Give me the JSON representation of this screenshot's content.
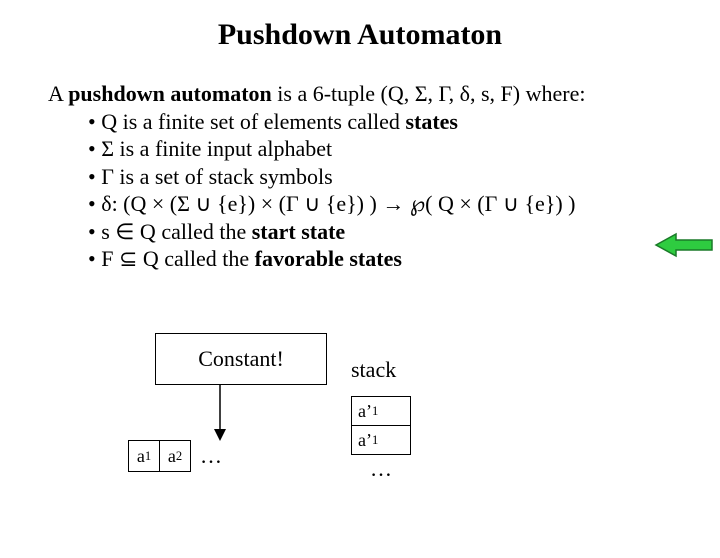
{
  "title": "Pushdown Automaton",
  "intro_prefix": "A ",
  "intro_bold": "pushdown automaton",
  "intro_suffix": " is a 6-tuple (Q, Σ, Γ, δ, s, F) where:",
  "bullets": {
    "b1_pre": "• Q is a finite set of elements called ",
    "b1_bold": "states",
    "b2": "• Σ is a finite input alphabet",
    "b3": "• Γ is a set of stack symbols",
    "b4": "• δ: (Q × (Σ ∪ {e}) × (Γ ∪ {e}) )  →  ℘( Q × (Γ ∪ {e}) )",
    "b5_pre": "• s ∈ Q called the ",
    "b5_bold": "start state",
    "b6_pre": "• F ⊆ Q called the ",
    "b6_bold": "favorable states"
  },
  "constant_label": "Constant!",
  "tape": {
    "a1_base": "a",
    "a1_sub": "1",
    "a2_base": "a",
    "a2_sub": "2",
    "dots": "…"
  },
  "stack_label": "stack",
  "stack": {
    "c1_base": "a’",
    "c1_sub": "1",
    "c2_base": "a’",
    "c2_sub": "1",
    "dots": "…"
  }
}
